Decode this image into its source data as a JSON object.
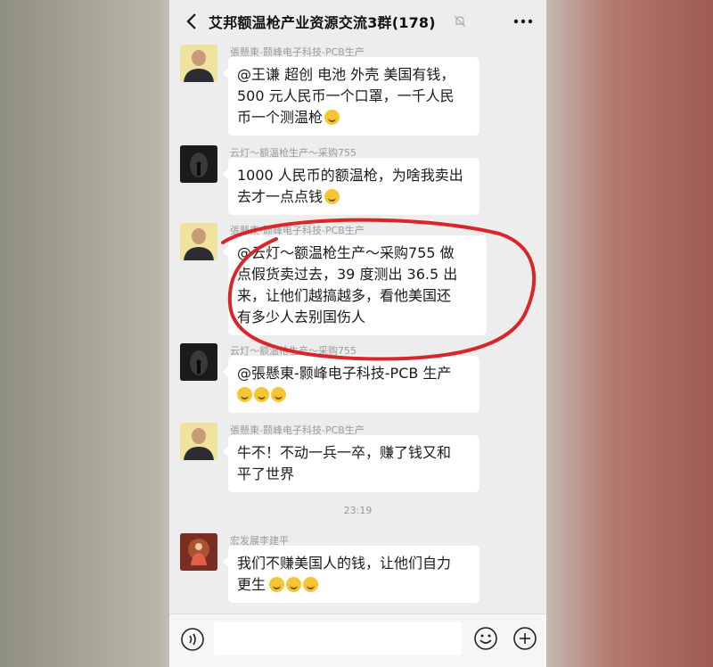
{
  "header": {
    "title": "艾邦额温枪产业资源交流3群(178)"
  },
  "messages": [
    {
      "sender": "張懸東-颢峰电子科技-PCB生产",
      "lines": [
        "@王谦 超创 电池 外壳  美国有钱，",
        "500 元人民币一个口罩，一千人民",
        "币一个测温枪"
      ],
      "emoji": [
        "grin-sweat-emoji"
      ]
    },
    {
      "sender": "云灯～额温枪生产～采购755",
      "lines": [
        "1000 人民币的额温枪，为啥我卖出",
        "去才一点点钱"
      ],
      "emoji": [
        "tears-of-joy-emoji"
      ]
    },
    {
      "sender": "張懸東-颢峰电子科技-PCB生产",
      "lines": [
        "@云灯～额温枪生产～采购755 做",
        "点假货卖过去，39 度测出 36.5 出",
        "来，让他们越搞越多，看他美国还",
        "有多少人去别国伤人"
      ],
      "emoji": []
    },
    {
      "sender": "云灯～额温枪生产～采购755",
      "lines": [
        "@張懸東-颢峰电子科技-PCB 生产"
      ],
      "emoji": [
        "tears-of-joy-emoji",
        "tears-of-joy-emoji",
        "tears-of-joy-emoji"
      ]
    },
    {
      "sender": "張懸東-颢峰电子科技-PCB生产",
      "lines": [
        "牛不！不动一兵一卒，赚了钱又和",
        "平了世界"
      ],
      "emoji": []
    },
    {
      "sender": "宏发展李建平",
      "lines": [
        "我们不赚美国人的钱，让他们自力",
        "更生"
      ],
      "emoji": [
        "smile-emoji",
        "smile-emoji",
        "smile-emoji"
      ]
    }
  ],
  "timestamp": "23:19",
  "input": {
    "placeholder": ""
  },
  "colors": {
    "bubble": "#ffffff",
    "chat_background": "#ededed",
    "annotation_circle": "#d9262b"
  }
}
